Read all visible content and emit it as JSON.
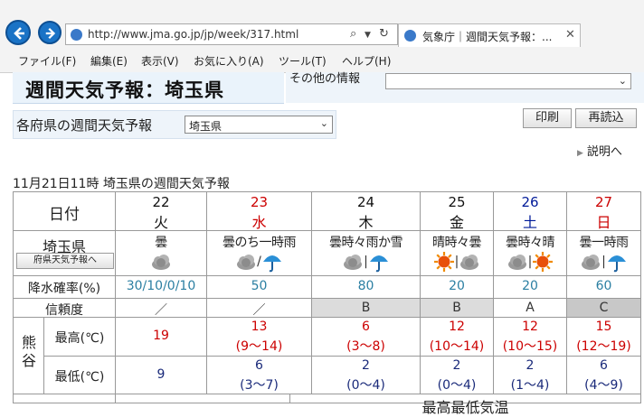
{
  "browser": {
    "url": "http://www.jma.go.jp/jp/week/317.html",
    "tab_title": "気象庁｜週間天気予報：...",
    "menu": [
      "ファイル(F)",
      "編集(E)",
      "表示(V)",
      "お気に入り(A)",
      "ツール(T)",
      "ヘルプ(H)"
    ]
  },
  "page": {
    "title": "週間天気予報：埼玉県",
    "other_info_label": "その他の情報",
    "other_info_value": "",
    "pref_label": "各府県の週間天気予報",
    "pref_value": "埼玉県",
    "print_label": "印刷",
    "reload_label": "再読込",
    "explain_label": "説明へ",
    "caption": "11月21日11時 埼玉県の週間天気予報"
  },
  "table": {
    "date_header": "日付",
    "region": "埼玉県",
    "region_button": "府県天気予報へ",
    "precip_label": "降水確率(%)",
    "reliability_label": "信頼度",
    "city": "熊谷",
    "max_label": "最高(℃)",
    "min_label": "最低(℃)",
    "footer": "最高最低気温",
    "days": [
      {
        "day": "22",
        "dow": "火",
        "color": "dark",
        "weather": "曇",
        "icons": [
          "cloud"
        ],
        "precip": "30/10/0/10",
        "rel": "／",
        "rel_bg": "#ffffff",
        "max": "19",
        "max_range": "",
        "min": "9",
        "min_range": ""
      },
      {
        "day": "23",
        "dow": "水",
        "color": "red",
        "weather": "曇のち一時雨",
        "icons": [
          "cloud",
          "/",
          "umbrella"
        ],
        "precip": "50",
        "rel": "／",
        "rel_bg": "#ffffff",
        "max": "13",
        "max_range": "(9〜14)",
        "min": "6",
        "min_range": "(3〜7)"
      },
      {
        "day": "24",
        "dow": "木",
        "color": "dark",
        "weather": "曇時々雨か雪",
        "icons": [
          "cloud",
          "|",
          "umbrella"
        ],
        "precip": "80",
        "rel": "B",
        "rel_bg": "#dcdcdc",
        "max": "6",
        "max_range": "(3〜8)",
        "min": "2",
        "min_range": "(0〜4)"
      },
      {
        "day": "25",
        "dow": "金",
        "color": "dark",
        "weather": "晴時々曇",
        "icons": [
          "sun",
          "|",
          "cloud"
        ],
        "precip": "20",
        "rel": "B",
        "rel_bg": "#dcdcdc",
        "max": "12",
        "max_range": "(10〜14)",
        "min": "2",
        "min_range": "(0〜4)"
      },
      {
        "day": "26",
        "dow": "土",
        "color": "navy",
        "weather": "曇時々晴",
        "icons": [
          "cloud",
          "|",
          "sun"
        ],
        "precip": "20",
        "rel": "A",
        "rel_bg": "#ffffff",
        "max": "12",
        "max_range": "(10〜15)",
        "min": "2",
        "min_range": "(1〜4)"
      },
      {
        "day": "27",
        "dow": "日",
        "color": "red",
        "weather": "曇一時雨",
        "icons": [
          "cloud",
          "|",
          "umbrella"
        ],
        "precip": "60",
        "rel": "C",
        "rel_bg": "#c8c8c8",
        "max": "15",
        "max_range": "(12〜19)",
        "min": "6",
        "min_range": "(4〜9)"
      }
    ]
  },
  "colors": {
    "red": "#cc0000",
    "navy": "#001a99",
    "precip": "#2b7fa2",
    "accent": "#1a73c6"
  }
}
